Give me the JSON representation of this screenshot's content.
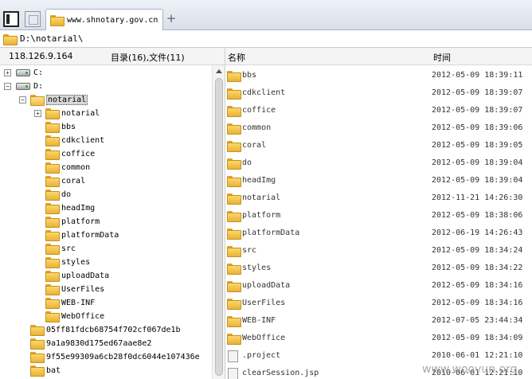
{
  "tab": {
    "title": "www.shnotary.gov.cn"
  },
  "address": {
    "path": "D:\\notarial\\"
  },
  "info": {
    "ip": "118.126.9.164",
    "counts": "目录(16),文件(11)"
  },
  "columns": {
    "name": "名称",
    "time": "时间"
  },
  "tree": {
    "drive_c": "C:",
    "drive_d": "D:",
    "selected": "notarial",
    "children": [
      "notarial",
      "bbs",
      "cdkclient",
      "coffice",
      "common",
      "coral",
      "do",
      "headImg",
      "platform",
      "platformData",
      "src",
      "styles",
      "uploadData",
      "UserFiles",
      "WEB-INF",
      "WebOffice"
    ],
    "siblings": [
      "05ff81fdcb68754f702cf067de1b",
      "9a1a9830d175ed67aae8e2",
      "9f55e99309a6cb28f0dc6044e107436e",
      "bat"
    ]
  },
  "files": [
    {
      "name": "bbs",
      "time": "2012-05-09 18:39:11",
      "type": "folder"
    },
    {
      "name": "cdkclient",
      "time": "2012-05-09 18:39:07",
      "type": "folder"
    },
    {
      "name": "coffice",
      "time": "2012-05-09 18:39:07",
      "type": "folder"
    },
    {
      "name": "common",
      "time": "2012-05-09 18:39:06",
      "type": "folder"
    },
    {
      "name": "coral",
      "time": "2012-05-09 18:39:05",
      "type": "folder"
    },
    {
      "name": "do",
      "time": "2012-05-09 18:39:04",
      "type": "folder"
    },
    {
      "name": "headImg",
      "time": "2012-05-09 18:39:04",
      "type": "folder"
    },
    {
      "name": "notarial",
      "time": "2012-11-21 14:26:30",
      "type": "folder"
    },
    {
      "name": "platform",
      "time": "2012-05-09 18:38:06",
      "type": "folder"
    },
    {
      "name": "platformData",
      "time": "2012-06-19 14:26:43",
      "type": "folder"
    },
    {
      "name": "src",
      "time": "2012-05-09 18:34:24",
      "type": "folder"
    },
    {
      "name": "styles",
      "time": "2012-05-09 18:34:22",
      "type": "folder"
    },
    {
      "name": "uploadData",
      "time": "2012-05-09 18:34:16",
      "type": "folder"
    },
    {
      "name": "UserFiles",
      "time": "2012-05-09 18:34:16",
      "type": "folder"
    },
    {
      "name": "WEB-INF",
      "time": "2012-07-05 23:44:34",
      "type": "folder"
    },
    {
      "name": "WebOffice",
      "time": "2012-05-09 18:34:09",
      "type": "folder"
    },
    {
      "name": ".project",
      "time": "2010-06-01 12:21:10",
      "type": "file"
    },
    {
      "name": "clearSession.jsp",
      "time": "2010-06-01 12:21:10",
      "type": "file"
    }
  ],
  "watermark": "www.wooyun.org"
}
